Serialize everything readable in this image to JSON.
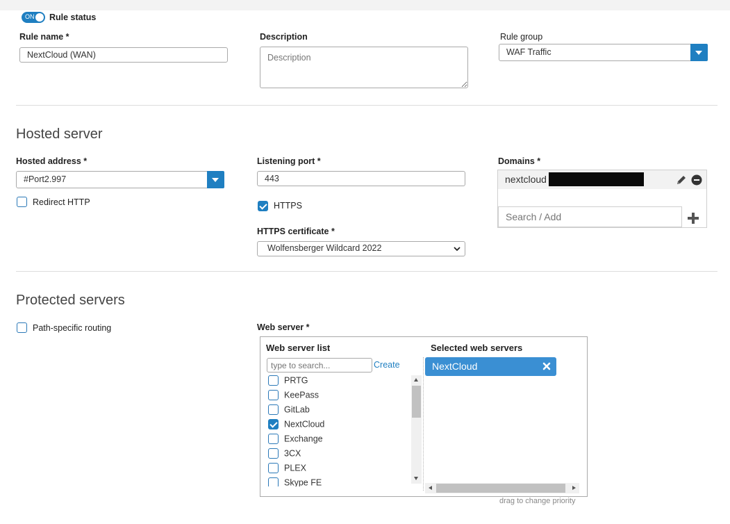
{
  "rule_status": {
    "toggle_text": "ON",
    "label": "Rule status",
    "enabled": true
  },
  "rule_name": {
    "label": "Rule name *",
    "value": "NextCloud (WAN)"
  },
  "description": {
    "label": "Description",
    "placeholder": "Description"
  },
  "rule_group": {
    "label": "Rule group",
    "value": "WAF Traffic"
  },
  "hosted_server": {
    "title": "Hosted server",
    "hosted_address": {
      "label": "Hosted address *",
      "value": "#Port2.997"
    },
    "redirect_http": {
      "label": "Redirect HTTP",
      "checked": false
    },
    "listening_port": {
      "label": "Listening port *",
      "value": "443"
    },
    "https": {
      "label": "HTTPS",
      "checked": true
    },
    "https_certificate": {
      "label": "HTTPS certificate *",
      "value": "Wolfensberger Wildcard 2022"
    },
    "domains": {
      "label": "Domains *",
      "entries": [
        "nextcloud"
      ],
      "search_placeholder": "Search / Add"
    }
  },
  "protected_servers": {
    "title": "Protected servers",
    "path_specific_routing": {
      "label": "Path-specific routing",
      "checked": false
    },
    "web_server": {
      "label": "Web server *",
      "list_title": "Web server list",
      "search_placeholder": "type to search...",
      "create_label": "Create",
      "items": [
        {
          "name": "PRTG",
          "checked": false
        },
        {
          "name": "KeePass",
          "checked": false
        },
        {
          "name": "GitLab",
          "checked": false
        },
        {
          "name": "NextCloud",
          "checked": true
        },
        {
          "name": "Exchange",
          "checked": false
        },
        {
          "name": "3CX",
          "checked": false
        },
        {
          "name": "PLEX",
          "checked": false
        },
        {
          "name": "Skype FE",
          "checked": false
        }
      ],
      "selected_title": "Selected web servers",
      "selected": [
        "NextCloud"
      ],
      "hint": "drag to change priority"
    }
  },
  "colors": {
    "accent": "#1f7fc1",
    "selected_chip": "#3a8fd3"
  }
}
